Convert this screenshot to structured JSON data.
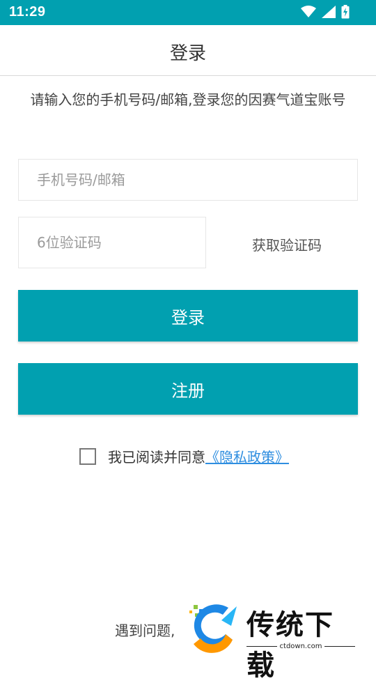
{
  "status_bar": {
    "time": "11:29",
    "icons": [
      "wifi-icon",
      "signal-icon",
      "battery-charging-icon"
    ],
    "background": "#01a0b0"
  },
  "header": {
    "title": "登录"
  },
  "subtitle": "请输入您的手机号码/邮箱,登录您的因赛气道宝账号",
  "form": {
    "account_placeholder": "手机号码/邮箱",
    "account_value": "",
    "code_placeholder": "6位验证码",
    "code_value": "",
    "get_code_label": "获取验证码"
  },
  "buttons": {
    "login_label": "登录",
    "register_label": "注册",
    "color": "#01a0b0"
  },
  "agreement": {
    "prefix": "我已阅读并同意",
    "link": "《隐私政策》",
    "checked": false
  },
  "footer": {
    "help_text": "遇到问题,",
    "logo_text": "传统下载",
    "logo_url_text": "ctdown.com"
  }
}
